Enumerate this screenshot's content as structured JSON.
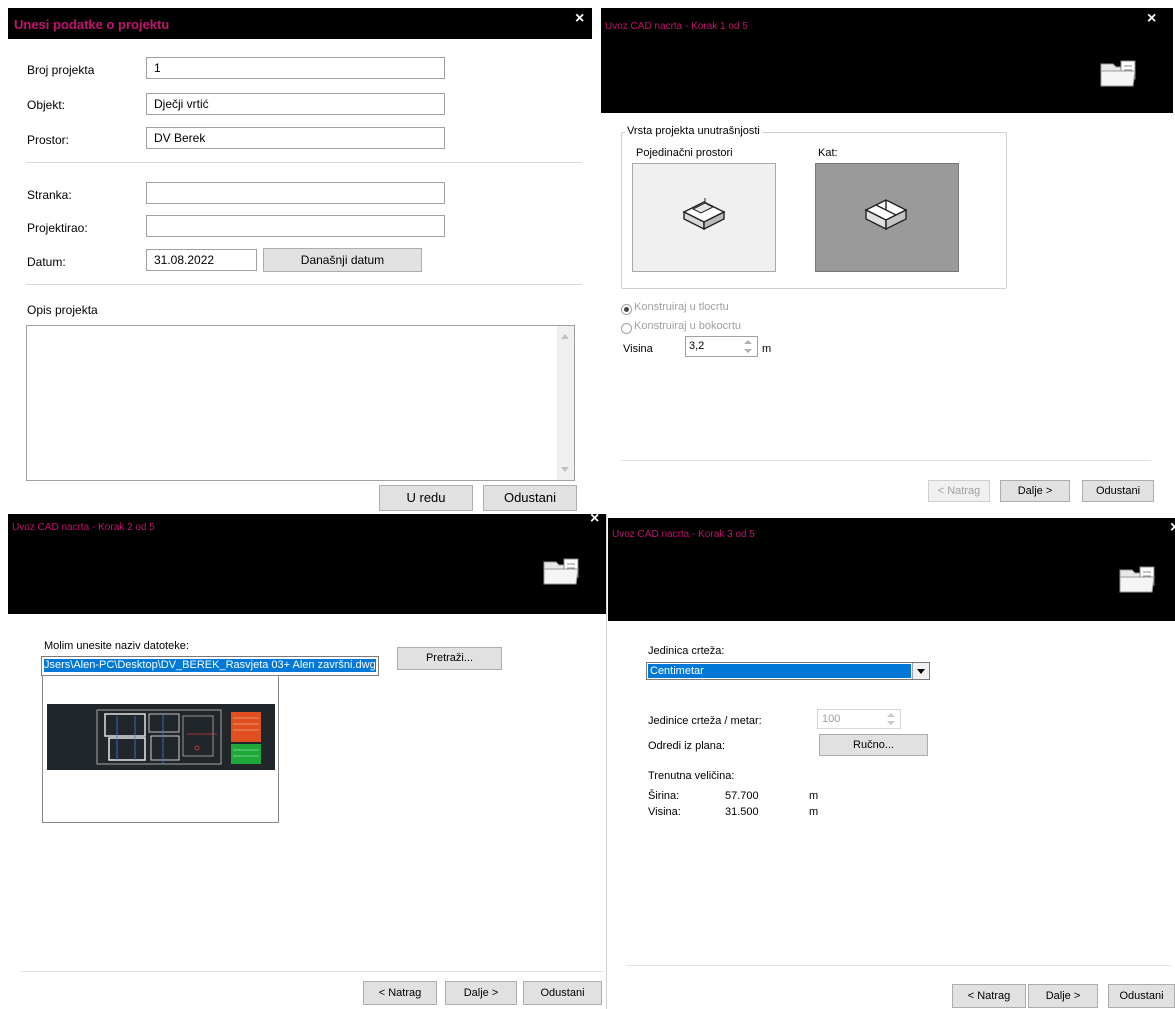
{
  "project_dialog": {
    "title": "Unesi podatke o projektu",
    "close_glyph": "×",
    "fields": {
      "broj_label": "Broj projekta",
      "broj_value": "1",
      "objekt_label": "Objekt:",
      "objekt_value": "Dječji vrtić",
      "prostor_label": "Prostor:",
      "prostor_value": "DV Berek",
      "stranka_label": "Stranka:",
      "stranka_value": "",
      "projektirao_label": "Projektirao:",
      "projektirao_value": "",
      "datum_label": "Datum:",
      "datum_value": "31.08.2022"
    },
    "today_button": "Današnji datum",
    "opis_label": "Opis projekta",
    "opis_value": "",
    "ok_button": "U redu",
    "cancel_button": "Odustani"
  },
  "step1": {
    "title": "Uvoz CAD nacrta - Korak 1 od 5",
    "close_glyph": "×",
    "group_label": "Vrsta projekta unutrašnjosti",
    "option_rooms": "Pojedinačni prostori",
    "option_floor": "Kat:",
    "radio_floor_plan": "Konstruiraj u tlocrtu",
    "radio_section": "Konstruiraj u bokocrtu",
    "height_label": "Visina",
    "height_value": "3,2",
    "height_unit": "m",
    "back_button": "< Natrag",
    "next_button": "Dalje >",
    "cancel_button": "Odustani"
  },
  "step2": {
    "title": "Uvoz CAD nacrta - Korak 2 od 5",
    "close_glyph": "×",
    "file_label": "Molim unesite naziv datoteke:",
    "file_value": "Jsers\\Alen-PC\\Desktop\\DV_BEREK_Rasvjeta 03+ Alen završni.dwg",
    "browse_button": "Pretraži...",
    "back_button": "< Natrag",
    "next_button": "Dalje >",
    "cancel_button": "Odustani"
  },
  "step3": {
    "title": "Uvoz CAD nacrta - Korak 3 od 5",
    "close_glyph": "×",
    "unit_label": "Jedinica crteža:",
    "unit_value": "Centimetar",
    "units_per_meter_label": "Jedinice crteža / metar:",
    "units_per_meter_value": "100",
    "determine_label": "Odredi iz plana:",
    "manual_button": "Ručno...",
    "current_size_label": "Trenutna veličina:",
    "width_label": "Širina:",
    "width_value": "57.700",
    "width_unit": "m",
    "height_label": "Visina:",
    "height_value": "31.500",
    "height_unit": "m",
    "back_button": "< Natrag",
    "next_button": "Dalje >",
    "cancel_button": "Odustani"
  },
  "colors": {
    "title_accent": "#c0146e",
    "titlebar": "#000000",
    "selection": "#0078d7"
  }
}
